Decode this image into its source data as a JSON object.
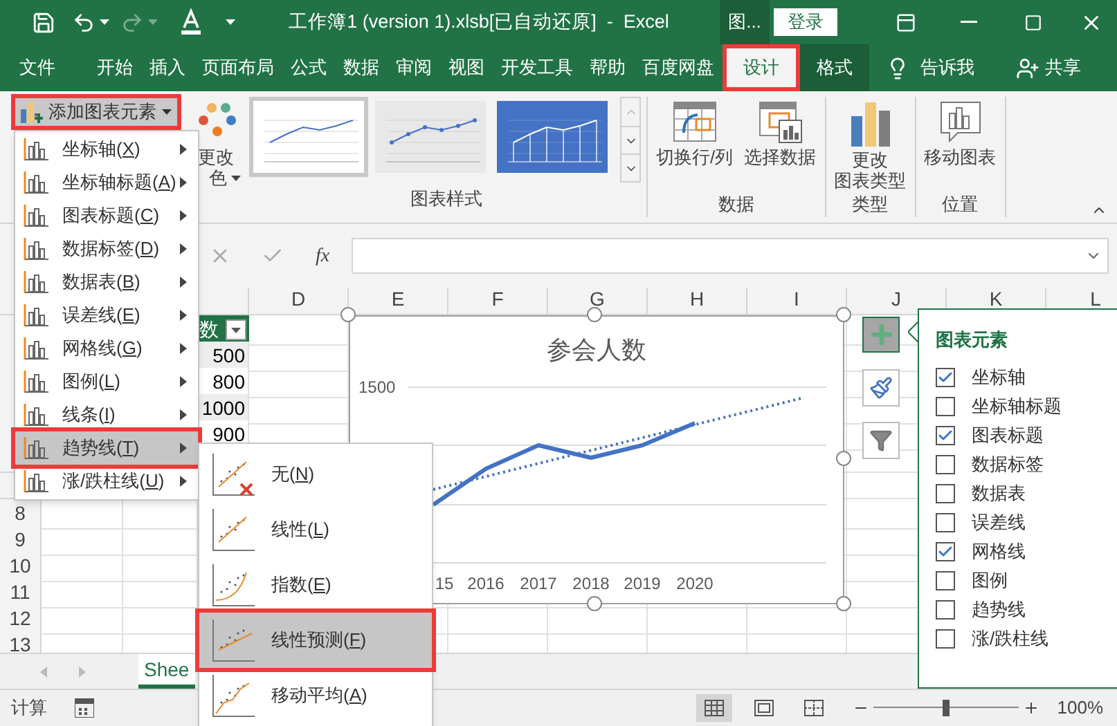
{
  "window": {
    "title": "工作簿1 (version 1).xlsb[已自动还原]  -  Excel",
    "context_group": "图...",
    "sign_in": "登录"
  },
  "tabs": [
    {
      "label": "文件",
      "selected": false,
      "kind": "normal"
    },
    {
      "label": "开始",
      "selected": false,
      "kind": "normal"
    },
    {
      "label": "插入",
      "selected": false,
      "kind": "normal"
    },
    {
      "label": "页面布局",
      "selected": false,
      "kind": "normal"
    },
    {
      "label": "公式",
      "selected": false,
      "kind": "normal"
    },
    {
      "label": "数据",
      "selected": false,
      "kind": "normal"
    },
    {
      "label": "审阅",
      "selected": false,
      "kind": "normal"
    },
    {
      "label": "视图",
      "selected": false,
      "kind": "normal"
    },
    {
      "label": "开发工具",
      "selected": false,
      "kind": "normal"
    },
    {
      "label": "帮助",
      "selected": false,
      "kind": "normal"
    },
    {
      "label": "百度网盘",
      "selected": false,
      "kind": "normal"
    },
    {
      "label": "设计",
      "selected": true,
      "kind": "context"
    },
    {
      "label": "格式",
      "selected": false,
      "kind": "context"
    }
  ],
  "tell_me": "告诉我",
  "share": "共享",
  "ribbon": {
    "add_element": "添加图表元素",
    "change_colors": [
      "更改",
      "色"
    ],
    "styles": [
      {
        "kind": "plain",
        "selected": true
      },
      {
        "kind": "gray",
        "selected": false
      },
      {
        "kind": "blue",
        "selected": false
      }
    ],
    "styles_label": "图表样式",
    "groups": [
      {
        "label": "数据",
        "buttons": [
          {
            "kind": "switch",
            "lines": [
              "切换行/列"
            ]
          },
          {
            "kind": "select",
            "lines": [
              "选择数据"
            ]
          }
        ]
      },
      {
        "label": "类型",
        "buttons": [
          {
            "kind": "type",
            "lines": [
              "更改",
              "图表类型"
            ]
          }
        ]
      },
      {
        "label": "位置",
        "buttons": [
          {
            "kind": "move",
            "lines": [
              "移动图表"
            ]
          }
        ]
      }
    ]
  },
  "formula_bar": {
    "function_label": "fx"
  },
  "columns": [
    "D",
    "E",
    "F",
    "G",
    "H",
    "I",
    "J",
    "K",
    "L"
  ],
  "table": {
    "header": "数",
    "values": [
      "500",
      "800",
      "1000",
      "900"
    ]
  },
  "row_numbers": [
    "8",
    "9",
    "10",
    "11",
    "12",
    "13"
  ],
  "chart": {
    "title": "参会人数",
    "y_tick": "1500",
    "x_labels": [
      "15",
      "2016",
      "2017",
      "2018",
      "2019",
      "2020"
    ]
  },
  "chart_elements": {
    "title": "图表元素",
    "items": [
      {
        "label": "坐标轴",
        "checked": true
      },
      {
        "label": "坐标轴标题",
        "checked": false
      },
      {
        "label": "图表标题",
        "checked": true
      },
      {
        "label": "数据标签",
        "checked": false
      },
      {
        "label": "数据表",
        "checked": false
      },
      {
        "label": "误差线",
        "checked": false
      },
      {
        "label": "网格线",
        "checked": true
      },
      {
        "label": "图例",
        "checked": false
      },
      {
        "label": "趋势线",
        "checked": false
      },
      {
        "label": "涨/跌柱线",
        "checked": false
      }
    ]
  },
  "menu": {
    "items": [
      {
        "label": "坐标轴(X)",
        "selected": false
      },
      {
        "label": "坐标轴标题(A)",
        "selected": false
      },
      {
        "label": "图表标题(C)",
        "selected": false
      },
      {
        "label": "数据标签(D)",
        "selected": false
      },
      {
        "label": "数据表(B)",
        "selected": false
      },
      {
        "label": "误差线(E)",
        "selected": false
      },
      {
        "label": "网格线(G)",
        "selected": false
      },
      {
        "label": "图例(L)",
        "selected": false
      },
      {
        "label": "线条(I)",
        "selected": false
      },
      {
        "label": "趋势线(T)",
        "selected": true
      },
      {
        "label": "涨/跌柱线(U)",
        "selected": false
      }
    ]
  },
  "submenu": {
    "items": [
      {
        "label": "无(N)",
        "kind": "none",
        "selected": false
      },
      {
        "label": "线性(L)",
        "kind": "linear",
        "selected": false
      },
      {
        "label": "指数(E)",
        "kind": "exponential",
        "selected": false
      },
      {
        "label": "线性预测(F)",
        "kind": "forecast",
        "selected": true
      },
      {
        "label": "移动平均(A)",
        "kind": "moving_average",
        "selected": false
      }
    ]
  },
  "sheet_tab": "Shee",
  "status_bar": {
    "mode": "计算",
    "zoom": {
      "level": 0.5,
      "reading": "100%"
    }
  }
}
